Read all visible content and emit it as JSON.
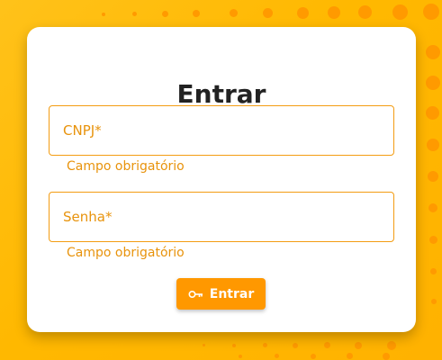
{
  "login": {
    "title": "Entrar",
    "cnpj_placeholder": "CNPJ*",
    "cnpj_helper": "Campo obrigatório",
    "password_placeholder": "Senha*",
    "password_helper": "Campo obrigatório",
    "submit_label": "Entrar",
    "submit_icon": "key-icon"
  },
  "colors": {
    "background": "#ffb800",
    "accent": "#ff9800",
    "error_text": "#e8930c",
    "card": "#ffffff"
  }
}
